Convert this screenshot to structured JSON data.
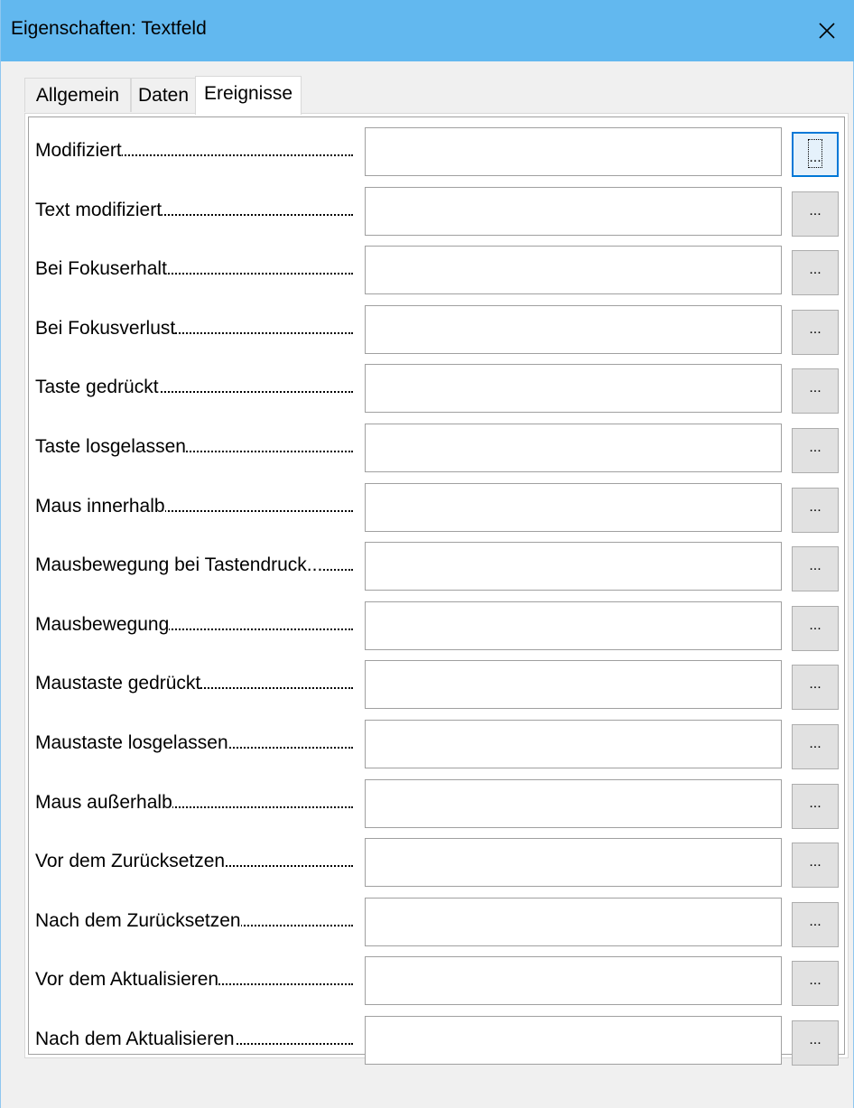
{
  "window": {
    "title": "Eigenschaften: Textfeld"
  },
  "tabs": [
    {
      "label": "Allgemein",
      "active": false
    },
    {
      "label": "Daten",
      "active": false
    },
    {
      "label": "Ereignisse",
      "active": true
    }
  ],
  "events": [
    {
      "label": "Modifiziert",
      "value": "",
      "button": "..."
    },
    {
      "label": "Text modifiziert",
      "value": "",
      "button": "..."
    },
    {
      "label": "Bei Fokuserhalt",
      "value": "",
      "button": "..."
    },
    {
      "label": "Bei Fokusverlust",
      "value": "",
      "button": "..."
    },
    {
      "label": "Taste gedrückt",
      "value": "",
      "button": "..."
    },
    {
      "label": "Taste losgelassen",
      "value": "",
      "button": "..."
    },
    {
      "label": "Maus innerhalb",
      "value": "",
      "button": "..."
    },
    {
      "label": "Mausbewegung bei Tastendruck...",
      "value": "",
      "button": "..."
    },
    {
      "label": "Mausbewegung",
      "value": "",
      "button": "..."
    },
    {
      "label": "Maustaste gedrückt",
      "value": "",
      "button": "..."
    },
    {
      "label": "Maustaste losgelassen",
      "value": "",
      "button": "..."
    },
    {
      "label": "Maus außerhalb",
      "value": "",
      "button": "..."
    },
    {
      "label": "Vor dem Zurücksetzen",
      "value": "",
      "button": "..."
    },
    {
      "label": "Nach dem Zurücksetzen",
      "value": "",
      "button": "..."
    },
    {
      "label": "Vor dem Aktualisieren",
      "value": "",
      "button": "..."
    },
    {
      "label": "Nach dem Aktualisieren",
      "value": "",
      "button": "..."
    }
  ],
  "colors": {
    "titlebar": "#62b8ef",
    "focus_accent": "#0078d7"
  }
}
